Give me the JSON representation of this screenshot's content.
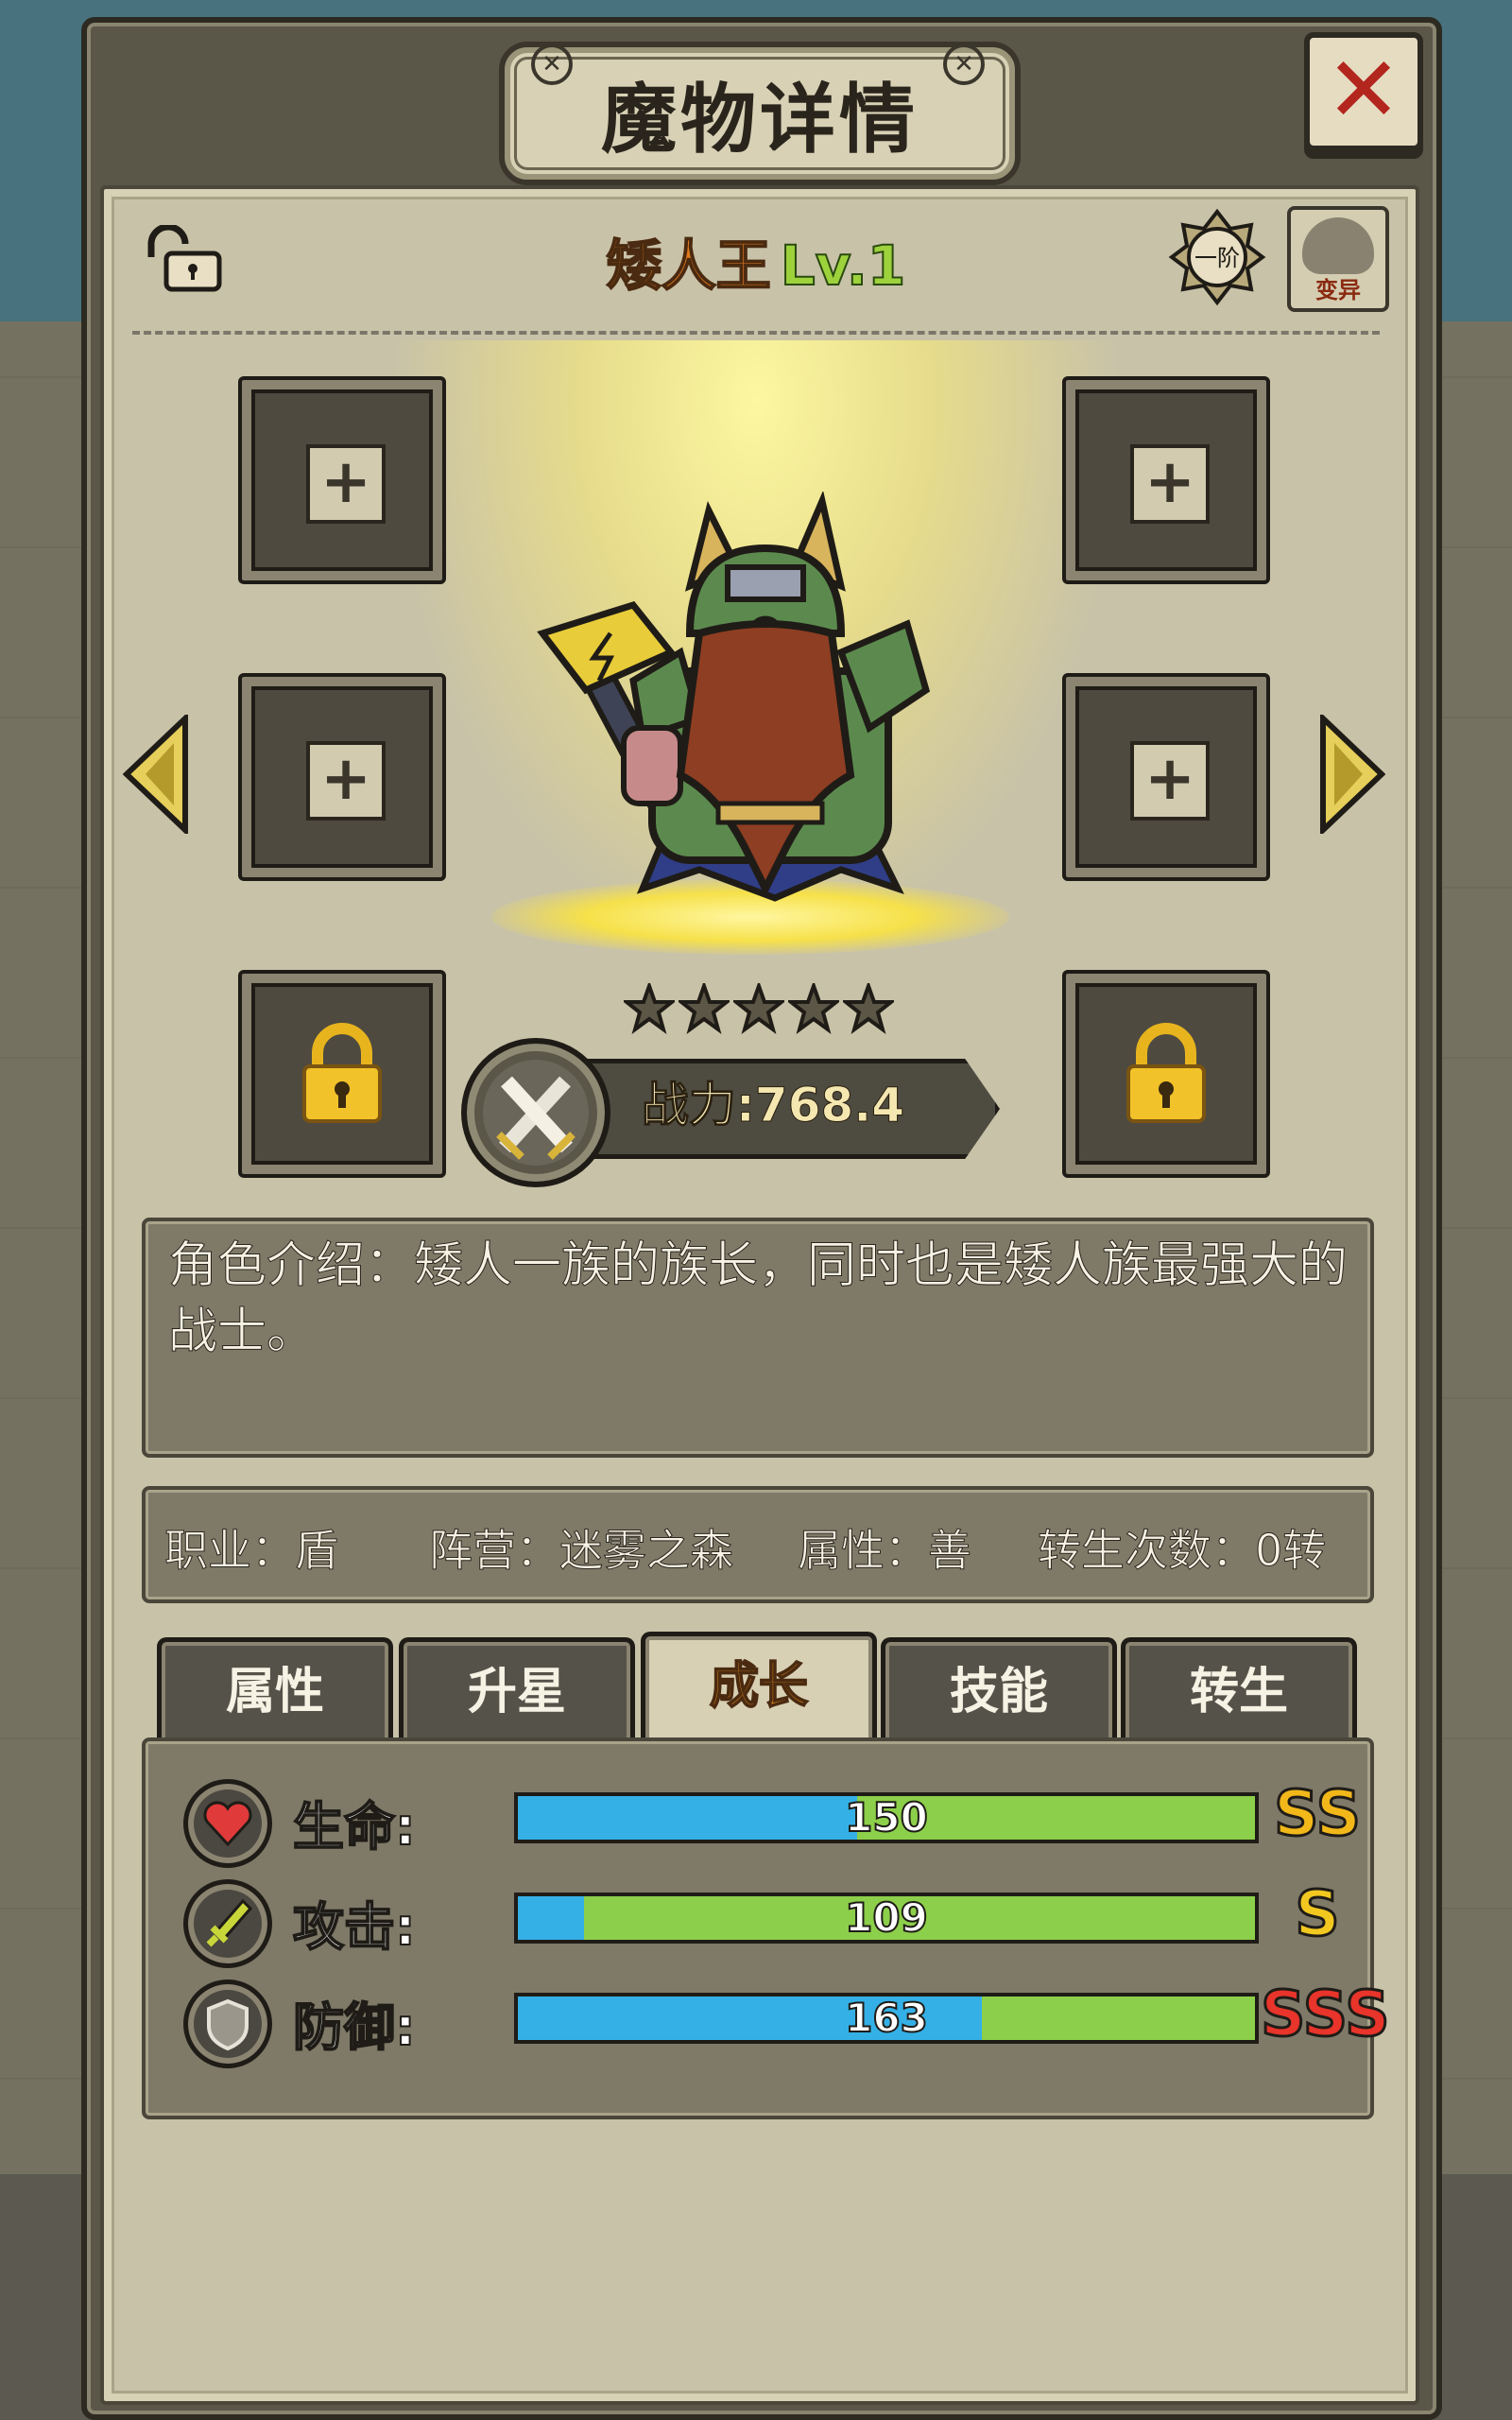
{
  "title": "魔物详情",
  "close_label": "✕",
  "monster": {
    "name": "矮人王",
    "level": "Lv.1",
    "rank": "一阶",
    "mutate_label": "变异",
    "stars": 5,
    "power_text": "战力:768.4",
    "description": "角色介绍：矮人一族的族长，同时也是矮人族最强大的战士。"
  },
  "info": {
    "job": "职业：盾",
    "camp": "阵营：迷雾之森",
    "attribute": "属性：善",
    "rebirth": "转生次数：0转"
  },
  "slots": [
    {
      "state": "empty",
      "symbol": "+"
    },
    {
      "state": "empty",
      "symbol": "+"
    },
    {
      "state": "empty",
      "symbol": "+"
    },
    {
      "state": "empty",
      "symbol": "+"
    },
    {
      "state": "locked"
    },
    {
      "state": "locked"
    }
  ],
  "tabs": [
    {
      "label": "属性",
      "active": false
    },
    {
      "label": "升星",
      "active": false
    },
    {
      "label": "成长",
      "active": true
    },
    {
      "label": "技能",
      "active": false
    },
    {
      "label": "转生",
      "active": false
    }
  ],
  "stats": [
    {
      "label": "生命:",
      "value": "150",
      "fill": 0.46,
      "grade": "SS",
      "grade_color": "#f2b81a",
      "icon": "heart-icon"
    },
    {
      "label": "攻击:",
      "value": "109",
      "fill": 0.09,
      "grade": "S",
      "grade_color": "#f2c820",
      "icon": "sword-icon"
    },
    {
      "label": "防御:",
      "value": "163",
      "fill": 0.63,
      "grade": "SSS",
      "grade_color": "#e8342a",
      "icon": "shield-icon"
    }
  ],
  "colors": {
    "bar_base": "#8ccf4a",
    "bar_fill": "#34b0e6",
    "name_color": "#e07a1c",
    "level_color": "#9dd23c"
  }
}
